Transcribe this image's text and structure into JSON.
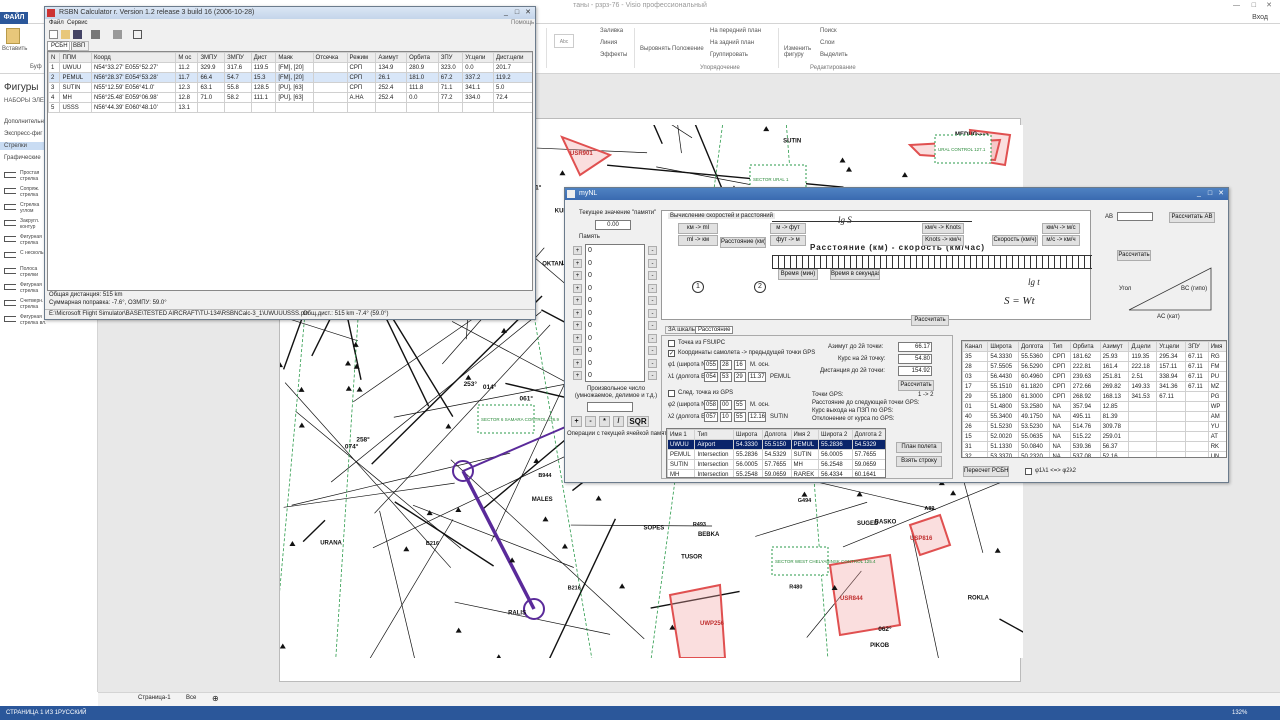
{
  "visio": {
    "title": "таны - рзрз-76 - Visio профессиональный",
    "file_tab": "ФАЙЛ",
    "user": "Вход",
    "ribbon": {
      "paste": "Вставить",
      "buffer": "Буф",
      "fill": "Заливка",
      "line": "Линия",
      "effects": "Эффекты",
      "align": "Выровнять",
      "position": "Положение",
      "front": "На передний план",
      "back": "На задний план",
      "group": "Группировать",
      "change_shape": "Изменить фигуру",
      "find": "Поиск",
      "layers": "Слои",
      "select": "Выделить",
      "arrange_group": "Упорядочение",
      "edit_group": "Редактирование"
    },
    "shapes_panel": {
      "title": "Фигуры",
      "subtitle": "НАБОРЫ ЭЛЕ",
      "items": [
        "Дополнительн",
        "Экспресс-фиг",
        "Стрелки",
        "Графические"
      ],
      "shapes": [
        "Простая стрелка",
        "Сопряж. стрелка",
        "Стрелка углом",
        "Закругл. контур",
        "Фигурная стрелка",
        "С несколь.",
        "Полоса стрелки",
        "Фигурная стрелка",
        "Счетверн. стрелка",
        "Фигурная стрелка вл."
      ],
      "shapes2": [
        "Тройная стрелка вл.",
        "Счетверен. фигурная"
      ]
    },
    "page_tab": "Страница-1",
    "all_tab": "Все",
    "status": "СТРАНИЦА 1 ИЗ 1",
    "lang": "РУССКИЙ",
    "zoom": "132%"
  },
  "calc": {
    "title": "RSBN Calculator r.   Version 1.2 release 3 build 16 (2006-10-28)",
    "menu": [
      "Файл",
      "Сервис"
    ],
    "help": "Помощь",
    "tabs": [
      "РСБН",
      "ВВП"
    ],
    "columns": [
      "N",
      "ППМ",
      "Коорд",
      "М ос",
      "ЗМПУ",
      "ЗМПУ",
      "Дист",
      "Маяк",
      "Отсечка",
      "Режим",
      "Азимут",
      "Орбита",
      "ЗПУ",
      "Уг.цели",
      "Дист.цели"
    ],
    "rows": [
      [
        "1",
        "UWUU",
        "N54°33.27' E055°52.27'",
        "11.2",
        "329.9",
        "317.6",
        "119.5",
        "[FM], [20]",
        "",
        "СРП",
        "134.9",
        "280.9",
        "323.0",
        "0.0",
        "201.7"
      ],
      [
        "2",
        "PEMUL",
        "N56°28.37' E054°53.28'",
        "11.7",
        "66.4",
        "54.7",
        "15.3",
        "[FM], [20]",
        "",
        "СРП",
        "26.1",
        "181.0",
        "67.2",
        "337.2",
        "119.2"
      ],
      [
        "3",
        "SUTIN",
        "N55°12.59' E056°41.0'",
        "12.3",
        "63.1",
        "55.8",
        "128.5",
        "[PU], [63]",
        "",
        "СРП",
        "252.4",
        "111.8",
        "71.1",
        "341.1",
        "5.0"
      ],
      [
        "4",
        "MH",
        "N56°25.48' E059°06.98'",
        "12.8",
        "71.0",
        "58.2",
        "111.1",
        "[PU], [63]",
        "",
        "А.НА",
        "252.4",
        "0.0",
        "77.2",
        "334.0",
        "72.4"
      ],
      [
        "5",
        "USSS",
        "N56°44.39' E060°48.10'",
        "13.1",
        "",
        "",
        "",
        "",
        "",
        "",
        "",
        "",
        "",
        "",
        ""
      ]
    ],
    "total": "Общая дистанция: 515 km",
    "correction": "Суммарная поправка: -7.6°, ОЗМПУ: 59.0°",
    "path": "E:\\Microsoft Flight Simulator\\BASE\\TESTED AIRCRAFT\\TU-134\\RSBNCalc-3_1\\UWUUUSSS.pln",
    "path2": "Общ.дист.: 515 km  -7.4° (59.0°)"
  },
  "nav": {
    "title": "myNL",
    "memory_label": "Текущее значение \"памяти\"",
    "memory_value": "0.00",
    "memory_caption": "Память",
    "mem_values": [
      "0",
      "0",
      "0",
      "0",
      "0",
      "0",
      "0",
      "0",
      "0",
      "0",
      "0"
    ],
    "arbitrary_label": "Произвольное число (умножаемое, делимое и т.д.)",
    "ops": [
      "+",
      "-",
      "*",
      "/",
      "SQR"
    ],
    "ops_caption": "Операции с текущей ячейкой памяти",
    "calc_title": "Вычисление скоростей и расстояний",
    "ruler_text": "Расстояние (км) - скорость (км/час)",
    "formula": "S = Wt",
    "formula_sub": "Время (мин)",
    "calc_button": "Рассчитать",
    "btns_left": [
      "км -> ml",
      "ml -> км",
      "Расстояние (км)"
    ],
    "btns_mid": [
      "м -> фут",
      "фут -> м",
      "Время (мин)",
      "Время в секундах"
    ],
    "btns_right": [
      "км/ч -> Knots",
      "Knots -> км/ч",
      "Скорость (км/ч)",
      "км/ч -> м/с",
      "м/с -> км/ч"
    ],
    "tabs": [
      "ЗА шкалы",
      "Расстояние"
    ],
    "fsuipc": "Точка из FSUIPC",
    "coords_chk": "Координаты самолета -> предыдущей точки GPS",
    "phi1_label": "φ1 (широта N)",
    "phi1": [
      "055",
      "28",
      "16"
    ],
    "phi1_unit": "М. осн.",
    "lambda1_label": "λ1 (долгота E)",
    "lambda1": [
      "054",
      "53",
      "29",
      "11.37"
    ],
    "point1_name": "PEMUL",
    "gps_point": "След. точка из GPS",
    "phi2_label": "φ2 (широта N)",
    "phi2": [
      "058",
      "00",
      "55"
    ],
    "phi2_unit": "М. осн.",
    "lambda2_label": "λ2 (долгота E)",
    "lambda2": [
      "057",
      "10",
      "55",
      "12.16"
    ],
    "point2_name": "SUTIN",
    "azimuth_label": "Азимут до 2й точки:",
    "azimuth": "66.17",
    "course_label": "Курс на 2й точку:",
    "course": "54.80",
    "distance_label": "Дистанция до 2й точки:",
    "distance": "154.92",
    "calc2": "Рассчитать",
    "gps_points": "Точки GPS:",
    "gps_count": "1 -> 2",
    "dist_next": "Расстояние до следующей точки GPS:",
    "course_exit": "Курс выхода на ПЗП по GPS:",
    "deviation": "Отклонение от курса по GPS:",
    "list_columns": [
      "Имя 1",
      "Тип",
      "Широта",
      "Долгота",
      "Имя 2",
      "Широта 2",
      "Долгота 2"
    ],
    "list_rows": [
      [
        "UWUU",
        "Airport",
        "54.3330",
        "55.5150",
        "PEMUL",
        "55.2836",
        "54.5329"
      ],
      [
        "PEMUL",
        "Intersection",
        "55.2836",
        "54.5329",
        "SUTIN",
        "56.0005",
        "57.7655"
      ],
      [
        "SUTIN",
        "Intersection",
        "56.0005",
        "57.7655",
        "MH",
        "56.2548",
        "59.0659"
      ],
      [
        "MH",
        "Intersection",
        "55.2548",
        "59.0659",
        "RAREK",
        "56.4334",
        "60.1641"
      ],
      [
        "RAREK",
        "Intersection",
        "56.4334",
        "60.1641",
        "USSS",
        "56.4435",
        "60.4812"
      ]
    ],
    "plan_btn": "План полета",
    "take_btn": "Взять строку",
    "rsbn_btn": "Пересчет РСБН",
    "phi_link": "φ1λ1 <=> φ2λ2",
    "ab_label": "AB",
    "calc_ab": "Рассчитать AB",
    "calc3": "Рассчитать",
    "table2_columns": [
      "Канал",
      "Широта",
      "Долгота",
      "Тип",
      "Орбита",
      "Азимут",
      "Д.цели",
      "Уг.цели",
      "ЗПУ",
      "Имя"
    ],
    "table2_rows": [
      [
        "35",
        "54.3330",
        "55.5360",
        "СРП",
        "181.62",
        "25.93",
        "119.35",
        "295.34",
        "67.11",
        "RG"
      ],
      [
        "28",
        "57.5505",
        "56.5290",
        "СРП",
        "222.81",
        "161.4",
        "222.18",
        "157.11",
        "67.11",
        "FM"
      ],
      [
        "03",
        "56.4430",
        "60.4960",
        "СРП",
        "239.63",
        "251.81",
        "2.51",
        "338.94",
        "67.11",
        "PU"
      ],
      [
        "17",
        "55.1510",
        "61.1820",
        "СРП",
        "272.66",
        "269.82",
        "149.33",
        "341.36",
        "67.11",
        "MZ"
      ],
      [
        "29",
        "55.1800",
        "61.3000",
        "СРП",
        "268.92",
        "168.13",
        "341.53",
        "67.11",
        "",
        "PG"
      ],
      [
        "01",
        "51.4800",
        "53.2580",
        "NA",
        "357.94",
        "12.85",
        "",
        "",
        "",
        "WP"
      ],
      [
        "40",
        "55.3400",
        "49.1750",
        "NA",
        "495.11",
        "81.39",
        "",
        "",
        "",
        "AM"
      ],
      [
        "26",
        "51.5230",
        "53.5230",
        "NA",
        "514.76",
        "309.78",
        "",
        "",
        "",
        "YU"
      ],
      [
        "15",
        "52.0020",
        "55.0635",
        "NA",
        "515.22",
        "259.01",
        "",
        "",
        "",
        "AT"
      ],
      [
        "31",
        "51.1330",
        "50.0840",
        "NA",
        "539.36",
        "56.37",
        "",
        "",
        "",
        "RK"
      ],
      [
        "32",
        "53.3370",
        "50.2320",
        "NA",
        "537.08",
        "52.16",
        "",
        "",
        "",
        "UN"
      ],
      [
        "52",
        "54.2420",
        "45.0000",
        "NA",
        "546.15",
        "117.07",
        "",
        "",
        "",
        "SY"
      ],
      [
        "73",
        "50.3370",
        "57.0000",
        "NA",
        "557.68",
        "311.42",
        "",
        "",
        "",
        "JC"
      ]
    ],
    "tri_labels": [
      "Угол",
      "BC (гипо)",
      "AC (кат)",
      "Кат",
      "α°"
    ]
  },
  "map": {
    "waypoints": [
      "PEMUL",
      "SUTIN",
      "OKNUR",
      "SOPES",
      "BEBKA",
      "ROKLA",
      "NEBUK",
      "KOTAG",
      "SUBIK",
      "LAKOL",
      "RALIS",
      "MEDUG",
      "MITKO",
      "PIKOB",
      "LANTO",
      "MALES",
      "TUSOR",
      "ASPUM",
      "SUGED",
      "BASKO",
      "ODEKU",
      "URANA",
      "NOGRI",
      "KAKOV",
      "KUMOK",
      "OKTAN",
      "DIMOR"
    ],
    "sectors": [
      "SECTOR 6 SAMARA CONTROL 126.9",
      "SECTOR WEST CHELYABINSK CONTROL 125.4",
      "URAL CONTROL 127.1",
      "SECTOR URAL 1"
    ],
    "zones": [
      "USR901",
      "USR844",
      "USP816",
      "UWP256"
    ],
    "nums": [
      "255°",
      "014°",
      "081°",
      "061°",
      "104°",
      "258°",
      "061°",
      "074°",
      "062°",
      "093°",
      "141°",
      "211°",
      "253°",
      "288°",
      "273°"
    ],
    "codes": [
      "B216",
      "R480",
      "B944",
      "R493",
      "A89",
      "B216",
      "G494",
      "R227"
    ]
  }
}
